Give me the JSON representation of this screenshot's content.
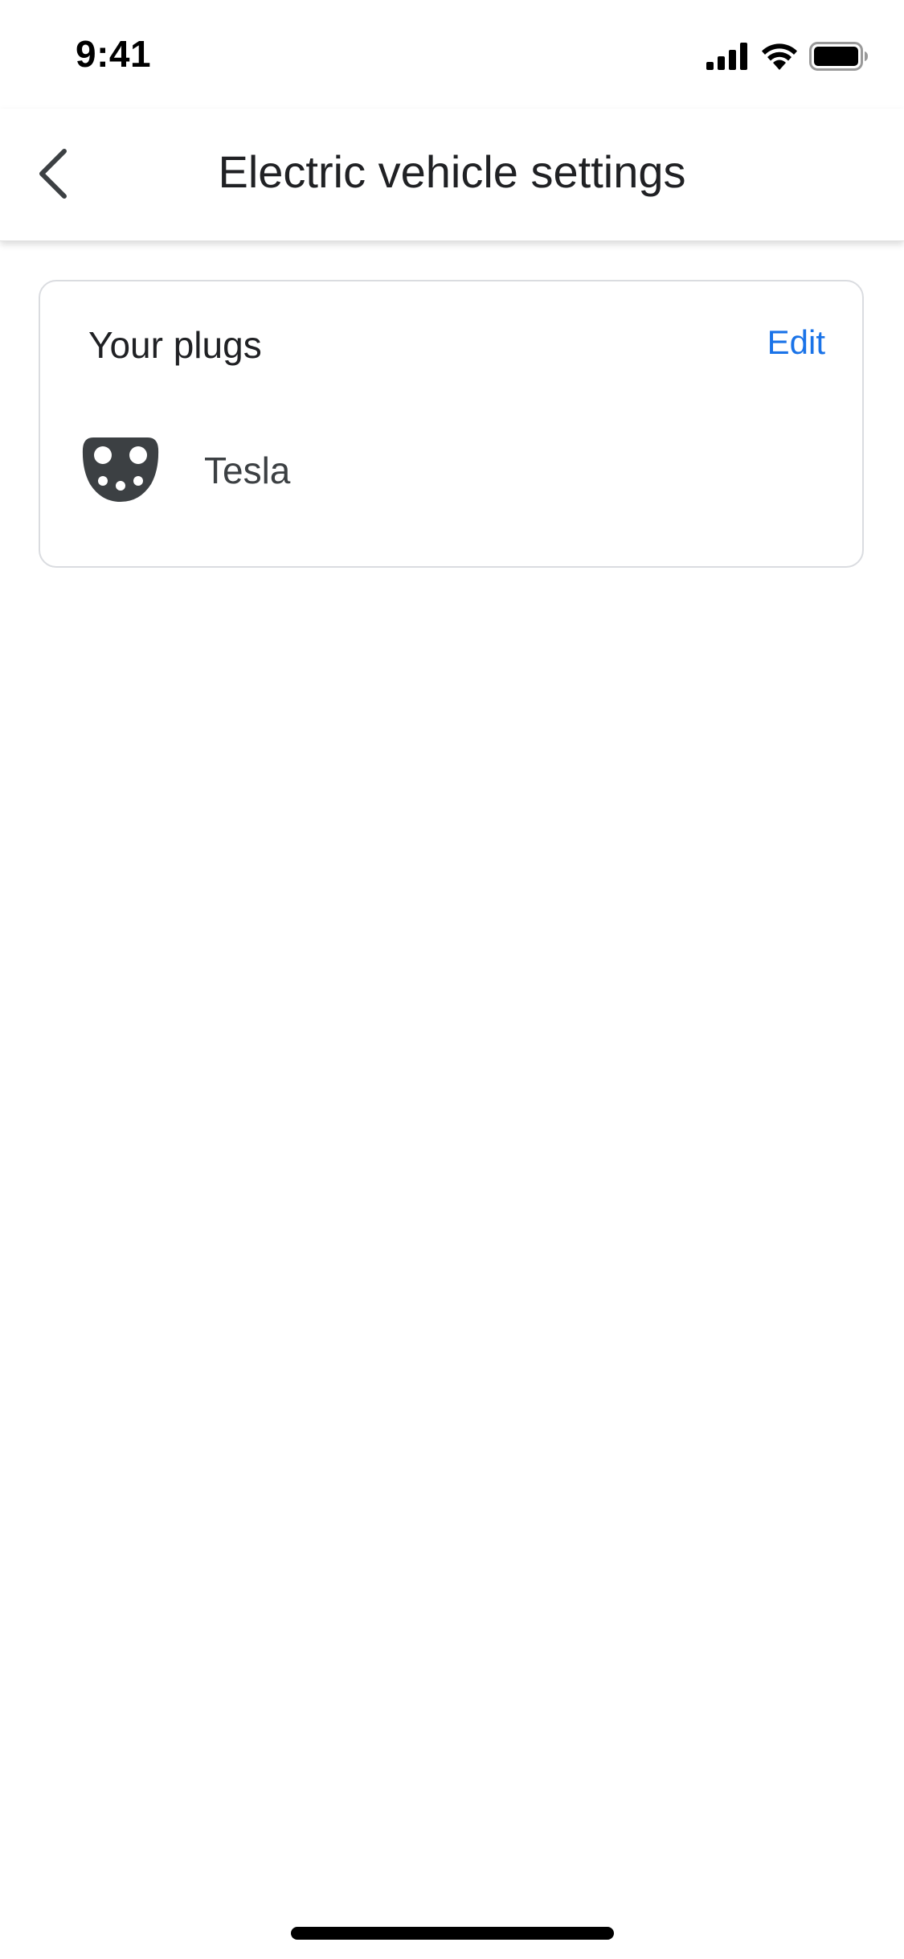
{
  "status_bar": {
    "time": "9:41",
    "icons": [
      "cellular-signal-icon",
      "wifi-icon",
      "battery-icon"
    ]
  },
  "header": {
    "back_icon": "chevron-left-icon",
    "title": "Electric vehicle settings"
  },
  "plugs_card": {
    "title": "Your plugs",
    "edit_label": "Edit",
    "plugs": [
      {
        "icon": "tesla-connector-icon",
        "label": "Tesla"
      }
    ]
  },
  "colors": {
    "accent": "#1a73e8",
    "title_text": "#202124",
    "secondary_text": "#3c4043",
    "icon": "#3c4043",
    "card_border": "#dadce0"
  }
}
